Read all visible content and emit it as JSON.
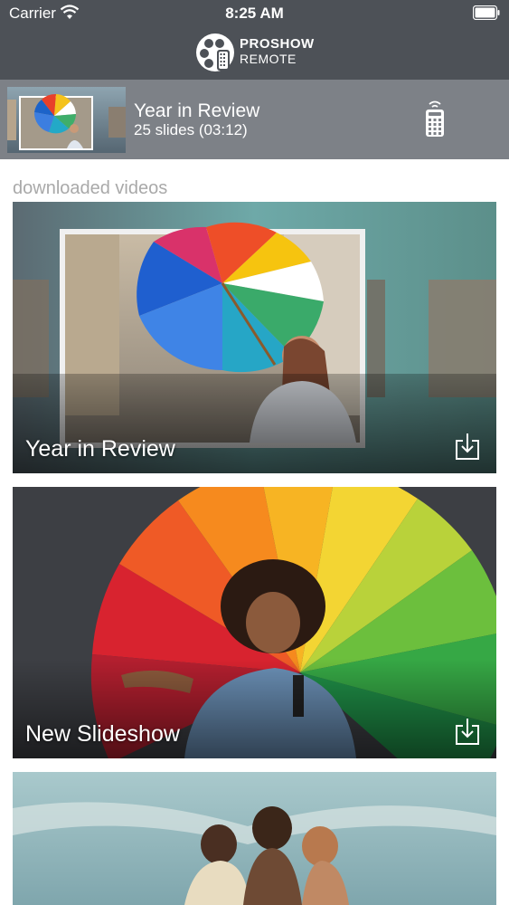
{
  "status_bar": {
    "carrier": "Carrier",
    "time": "8:25 AM"
  },
  "header": {
    "logo_line1": "PROSHOW",
    "logo_line2": "REMOTE"
  },
  "now_playing": {
    "title": "Year in Review",
    "subtitle": "25 slides (03:12)",
    "remote_icon": "remote-control-icon"
  },
  "section": {
    "label": "downloaded videos"
  },
  "videos": [
    {
      "title": "Year in Review",
      "icon": "download-icon"
    },
    {
      "title": "New Slideshow",
      "icon": "download-icon"
    },
    {
      "title": ""
    }
  ],
  "colors": {
    "header_bg": "#4d5157",
    "nowbar_bg": "#7d8187",
    "section_label": "#a9a9a9"
  }
}
